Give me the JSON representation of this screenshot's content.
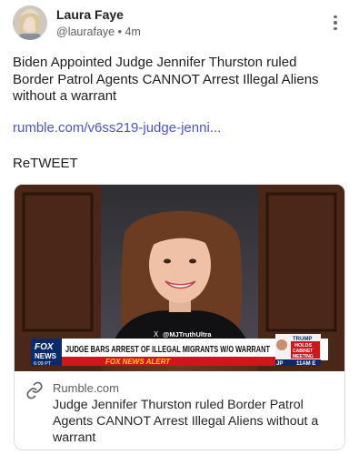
{
  "author": {
    "name": "Laura Faye",
    "handle": "@laurafaye",
    "separator": "•",
    "time": "4m"
  },
  "post": {
    "text": "Biden Appointed Judge Jennifer Thurston ruled Border Patrol Agents CANNOT Arrest Illegal Aliens without a warrant",
    "link_text": "rumble.com/v6ss219-judge-jenni...",
    "retweet": "ReTWEET"
  },
  "card": {
    "domain": "Rumble.com",
    "title": "Judge Jennifer Thurston ruled Border Patrol Agents CANNOT Arrest Illegal Aliens without a warrant",
    "image": {
      "watermark": "@MJTruthUltra",
      "network": "FOX",
      "network_sub": "NEWS",
      "clock": "6:09 PT",
      "headline": "JUDGE BARS ARREST OF ILLEGAL MIGRANTS W/O WARRANT",
      "alert": "FOX NEWS ALERT",
      "side_top": "TRUMP",
      "side_mid": "HOLDS",
      "side_line1": "CABINET",
      "side_line2": "MEETING",
      "side_time": "11AM E",
      "side_left": "JP"
    }
  },
  "colors": {
    "link": "#4b56c9",
    "fox_blue": "#0a2a6b",
    "alert_red": "#d2141b"
  },
  "icons": {
    "menu": "more-vertical-icon",
    "link": "link-icon",
    "x_logo": "x-logo-icon"
  }
}
